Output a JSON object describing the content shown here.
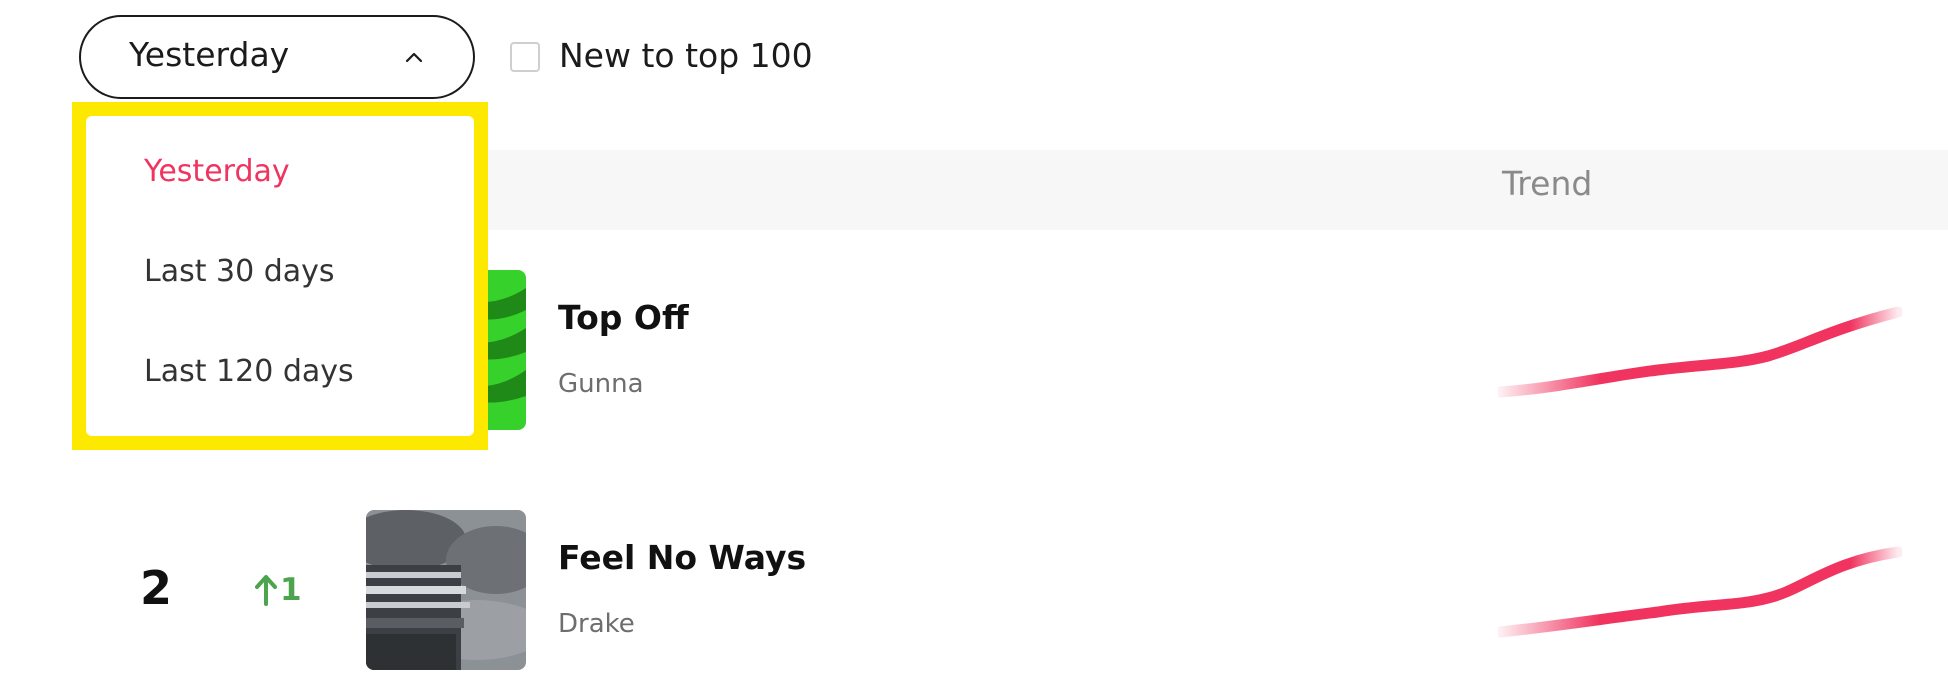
{
  "filters": {
    "period_select": {
      "value": "Yesterday",
      "icon": "chevron-up-icon",
      "options": [
        "Yesterday",
        "Last 30 days",
        "Last 120 days"
      ],
      "selected_index": 0
    },
    "new_to_top_100": {
      "label": "New to top 100",
      "checked": false
    }
  },
  "table": {
    "trend_header": "Trend"
  },
  "rows": [
    {
      "rank": "",
      "change": "",
      "title": "Top Off",
      "artist": "Gunna"
    },
    {
      "rank": "2",
      "change": "1",
      "change_icon": "arrow-up-icon",
      "title": "Feel No Ways",
      "artist": "Drake"
    }
  ],
  "colors": {
    "accent": "#f0345f",
    "highlight": "#fde800",
    "positive": "#4ca54c",
    "header_bg": "#f7f7f7"
  }
}
